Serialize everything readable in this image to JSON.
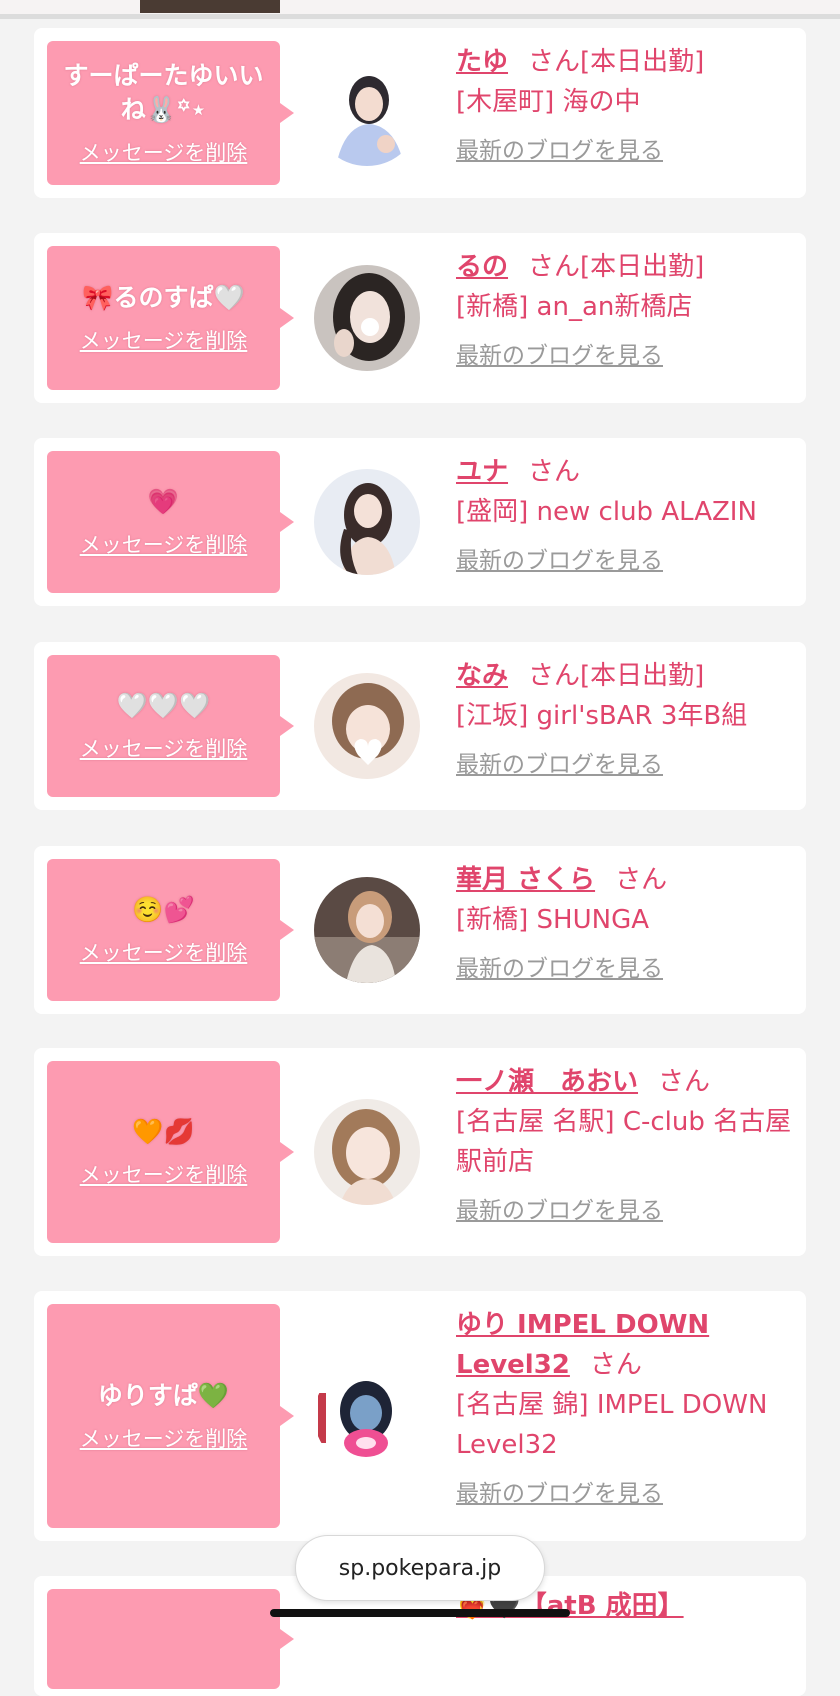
{
  "browser": {
    "url": "sp.pokepara.jp"
  },
  "colors": {
    "accent": "#e0456c",
    "bubble": "#fd9bb1",
    "link_gray": "#9a9a9a",
    "background": "#f3f3f3"
  },
  "cards": [
    {
      "message": "すーぱーたゆいいね🐰꙳⋆",
      "delete_label": "メッセージを削除",
      "name": "たゆ",
      "honorific": "さん",
      "status": "[本日出勤]",
      "shop": "[木屋町] 海の中",
      "blog_label": "最新のブログを見る"
    },
    {
      "message": "🎀るのすぱ🤍",
      "delete_label": "メッセージを削除",
      "name": "るの",
      "honorific": "さん",
      "status": "[本日出勤]",
      "shop": "[新橋] an_an新橋店",
      "blog_label": "最新のブログを見る"
    },
    {
      "message": "💗",
      "delete_label": "メッセージを削除",
      "name": "ユナ",
      "honorific": "さん",
      "status": "",
      "shop": "[盛岡] new club ALAZIN",
      "blog_label": "最新のブログを見る"
    },
    {
      "message": "🤍🤍🤍",
      "delete_label": "メッセージを削除",
      "name": "なみ",
      "honorific": "さん",
      "status": "[本日出勤]",
      "shop": "[江坂] girl'sBAR 3年B組",
      "blog_label": "最新のブログを見る"
    },
    {
      "message": "☺️💕",
      "delete_label": "メッセージを削除",
      "name": "華月 さくら",
      "honorific": "さん",
      "status": "",
      "shop": "[新橋] SHUNGA",
      "blog_label": "最新のブログを見る"
    },
    {
      "message": "🧡💋",
      "delete_label": "メッセージを削除",
      "name": "一ノ瀬　あおい",
      "honorific": "さん",
      "status": "",
      "shop": "[名古屋 名駅] C-club 名古屋駅前店",
      "blog_label": "最新のブログを見る"
    },
    {
      "message": "ゆりすぱ💚",
      "delete_label": "メッセージを削除",
      "name": "ゆり IMPEL DOWN Level32",
      "honorific": "さん",
      "status": "",
      "shop": "[名古屋 錦] IMPEL DOWN Level32",
      "blog_label": "最新のブログを見る"
    },
    {
      "message": "",
      "delete_label": "",
      "name": "❤️‍🔥🖤【atB 成田】",
      "honorific": "",
      "status": "",
      "shop": "",
      "blog_label": ""
    }
  ]
}
